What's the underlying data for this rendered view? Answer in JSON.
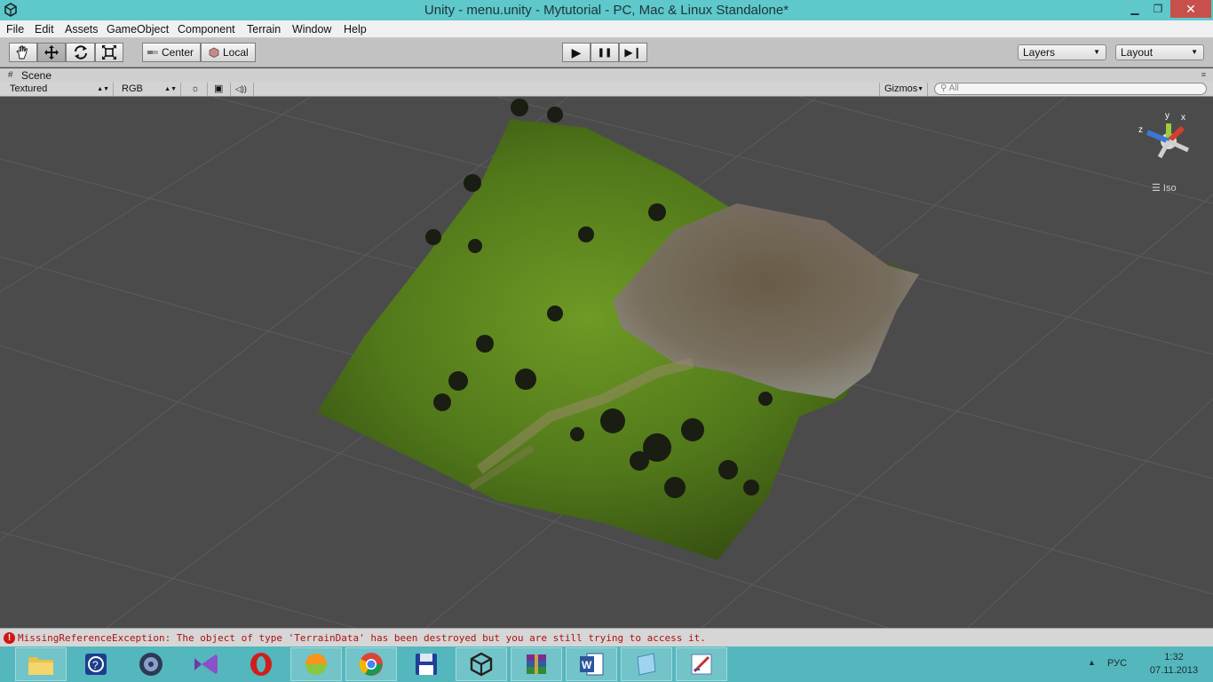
{
  "window": {
    "title": "Unity - menu.unity - Mytutorial - PC, Mac & Linux Standalone*",
    "minimize": "▁",
    "restore": "❐",
    "close": "✕"
  },
  "menu": [
    "File",
    "Edit",
    "Assets",
    "GameObject",
    "Component",
    "Terrain",
    "Window",
    "Help"
  ],
  "toolbar": {
    "tools": [
      "hand-tool-icon",
      "move-tool-icon",
      "rotate-tool-icon",
      "scale-tool-icon"
    ],
    "pivot": "Center",
    "space": "Local",
    "play": "▶",
    "pause": "❚❚",
    "step": "▶❙",
    "layers": "Layers",
    "layout": "Layout"
  },
  "scene_tab": {
    "label": "Scene",
    "grid_icon": "#",
    "menu_icon": "≡"
  },
  "scene_toolbar": {
    "draw_mode": "Textured",
    "render_mode": "RGB",
    "gizmos": "Gizmos",
    "search_placeholder": "All",
    "lighting_icon": "☼",
    "image_icon": "▣",
    "audio_icon": "◁))"
  },
  "gizmo": {
    "y": "y",
    "x": "x",
    "z": "z",
    "projection": "Iso"
  },
  "console": {
    "error": "MissingReferenceException: The object of type 'TerrainData' has been destroyed but you are still trying to access it."
  },
  "taskbar": {
    "apps": [
      "file-explorer-icon",
      "help-icon",
      "media-player-icon",
      "visual-studio-icon",
      "opera-icon",
      "browser-icon",
      "chrome-icon",
      "save-icon",
      "unity-icon",
      "winrar-icon",
      "word-icon",
      "notepad-icon",
      "paint-icon"
    ],
    "lang": "РУС",
    "time": "1:32",
    "date": "07.11.2013"
  },
  "colors": {
    "titlebar": "#5ec8cb",
    "taskbar": "#54b7bd",
    "error": "#d01515",
    "scene_bg": "#4b4b4b"
  }
}
